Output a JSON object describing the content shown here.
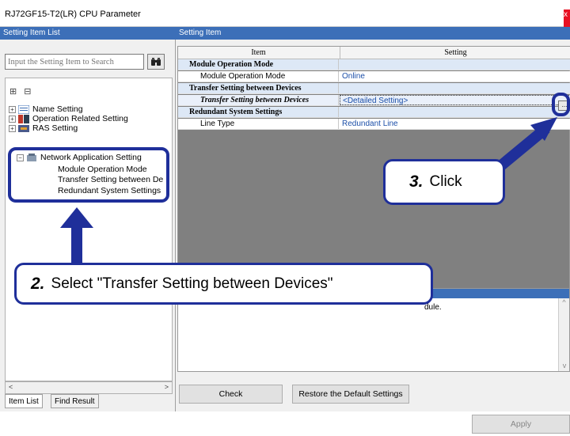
{
  "window": {
    "title": "RJ72GF15-T2(LR) CPU Parameter",
    "close_label": "x"
  },
  "left_panel": {
    "header": "Setting Item List",
    "search_placeholder": "Input the Setting Item to Search",
    "tree": {
      "name_setting": "Name Setting",
      "operation_related": "Operation Related Setting",
      "ras_setting": "RAS Setting",
      "network_app": "Network Application Setting",
      "module_mode": "Module Operation Mode",
      "transfer_setting": "Transfer Setting between De",
      "redundant": "Redundant System Settings"
    },
    "tabs": [
      "Item List",
      "Find Result"
    ]
  },
  "right_panel": {
    "header": "Setting Item",
    "columns": [
      "Item",
      "Setting"
    ],
    "rows": [
      {
        "item": "Module Operation Mode",
        "setting": ""
      },
      {
        "item": "Module Operation Mode",
        "setting": "Online"
      },
      {
        "item": "Transfer Setting between Devices",
        "setting": ""
      },
      {
        "item": "Transfer Setting between Devices",
        "setting": "<Detailed Setting>"
      },
      {
        "item": "Redundant System Settings",
        "setting": ""
      },
      {
        "item": "Line Type",
        "setting": "Redundant Line"
      }
    ],
    "description_fragment": "dule.",
    "buttons": {
      "check": "Check",
      "restore": "Restore the Default Settings",
      "apply": "Apply"
    },
    "dots_label": "..."
  },
  "callouts": {
    "step2_num": "2.",
    "step2_text": "Select \"Transfer Setting between Devices\"",
    "step3_num": "3.",
    "step3_text": "Click"
  },
  "colors": {
    "accent": "#1f2f9a",
    "header": "#3c6fb8",
    "grid_bg": "#808080"
  }
}
